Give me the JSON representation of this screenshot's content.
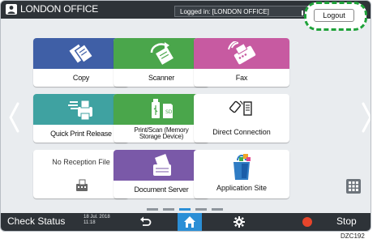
{
  "header": {
    "office_name": "LONDON OFFICE",
    "logged_in_text": "Logged in: [LONDON OFFICE]",
    "logout_label": "Logout",
    "user_icon": "user-icon"
  },
  "apps": [
    {
      "label": "Copy",
      "icon": "copy-icon"
    },
    {
      "label": "Scanner",
      "icon": "scanner-icon"
    },
    {
      "label": "Fax",
      "icon": "fax-icon"
    },
    {
      "label": "Quick Print Release",
      "icon": "quick-print-icon"
    },
    {
      "label": "Print/Scan (Memory\nStorage Device)",
      "icon": "memory-storage-icon"
    },
    {
      "label": "Direct Connection",
      "icon": "direct-connection-icon"
    },
    {
      "label": "No Reception File",
      "icon": "no-reception-file-icon"
    },
    {
      "label": "Document Server",
      "icon": "document-server-icon"
    },
    {
      "label": "Application Site",
      "icon": "application-site-icon"
    }
  ],
  "bottom": {
    "check_status": "Check Status",
    "date": "18 Jul. 2018",
    "time": "11:18",
    "stop_label": "Stop",
    "icons": [
      "back-icon",
      "home-icon",
      "settings-icon",
      "stop-icon",
      "app-list-icon"
    ]
  },
  "page_indicator": {
    "count": 5,
    "active": 3
  },
  "caption": "DZC192",
  "colors": {
    "bar": "#2e3338",
    "copy": "#3f5fa6",
    "scanner": "#4aa64b",
    "fax": "#c75aa1",
    "quick_print": "#3fa2a1",
    "document_server": "#7a59a8",
    "accent": "#2b8fd6",
    "highlight": "#1fa23a"
  }
}
